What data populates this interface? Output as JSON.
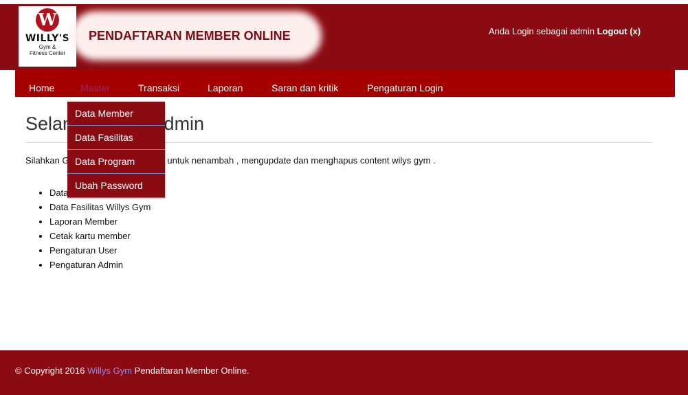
{
  "header": {
    "logo": {
      "letter": "W",
      "brand": "WILLY'S",
      "sub1": "Gym &",
      "sub2": "Fitness Center"
    },
    "site_title": "PENDAFTARAN MEMBER ONLINE",
    "login_prefix": "Anda Login sebagai admin",
    "logout_label": "Logout (x)"
  },
  "nav": {
    "items": [
      {
        "label": "Home"
      },
      {
        "label": "Master"
      },
      {
        "label": "Transaksi"
      },
      {
        "label": "Laporan"
      },
      {
        "label": "Saran dan kritik"
      },
      {
        "label": "Pengaturan Login"
      }
    ],
    "active": "Master"
  },
  "dropdown": {
    "items": [
      {
        "label": "Data Member"
      },
      {
        "label": "Data Fasilitas"
      },
      {
        "label": "Data Program"
      },
      {
        "label": "Ubah Password"
      }
    ]
  },
  "main": {
    "title_start": "Selam",
    "title_end": "admin",
    "intro_start": "Silahkan G",
    "intro_end": "a untuk nenambah , mengupdate dan menghapus content wilys gym .",
    "list": [
      "Data",
      "Data Fasilitas Willys Gym",
      "Laporan Member",
      "Cetak kartu member",
      "Pengaturan User",
      "Pengaturan Admin"
    ]
  },
  "footer": {
    "prefix": "© Copyright 2016",
    "brand": "Willys Gym",
    "suffix": "Pendaftaran Member Online."
  },
  "colors": {
    "header_bg": "#8b0b12",
    "nav_bg": "#a40000",
    "link": "#8a8ef0"
  }
}
